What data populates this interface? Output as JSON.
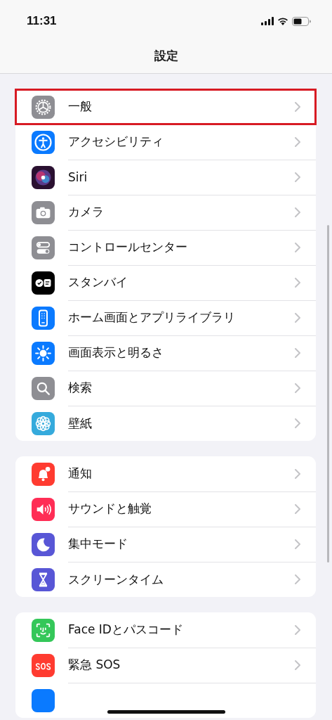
{
  "status_bar": {
    "time": "11:31"
  },
  "nav": {
    "title": "設定"
  },
  "groups": [
    {
      "items": [
        {
          "label": "一般",
          "color": "#8e8e93",
          "highlighted": true
        },
        {
          "label": "アクセシビリティ",
          "color": "#0a7aff",
          "highlighted": false
        },
        {
          "label": "Siri",
          "color": "#2a1030",
          "highlighted": false
        },
        {
          "label": "カメラ",
          "color": "#8e8e93",
          "highlighted": false
        },
        {
          "label": "コントロールセンター",
          "color": "#8e8e93",
          "highlighted": false
        },
        {
          "label": "スタンバイ",
          "color": "#000000",
          "highlighted": false
        },
        {
          "label": "ホーム画面とアプリライブラリ",
          "color": "#0a7aff",
          "highlighted": false
        },
        {
          "label": "画面表示と明るさ",
          "color": "#0a7aff",
          "highlighted": false
        },
        {
          "label": "検索",
          "color": "#8e8e93",
          "highlighted": false
        },
        {
          "label": "壁紙",
          "color": "#35aadc",
          "highlighted": false
        }
      ]
    },
    {
      "items": [
        {
          "label": "通知",
          "color": "#ff3b30",
          "highlighted": false
        },
        {
          "label": "サウンドと触覚",
          "color": "#ff2d55",
          "highlighted": false
        },
        {
          "label": "集中モード",
          "color": "#5856d6",
          "highlighted": false
        },
        {
          "label": "スクリーンタイム",
          "color": "#5856d6",
          "highlighted": false
        }
      ]
    },
    {
      "items": [
        {
          "label": "Face IDとパスコード",
          "color": "#34c759",
          "highlighted": false
        },
        {
          "label": "緊急 SOS",
          "color": "#ff3b30",
          "highlighted": false
        },
        {
          "color": "#0a7aff",
          "highlighted": false
        }
      ]
    }
  ]
}
